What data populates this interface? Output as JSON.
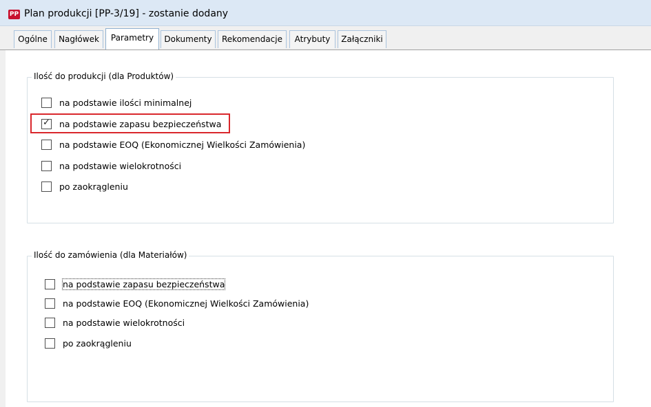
{
  "window": {
    "icon_text": "PP",
    "title": "Plan produkcji [PP-3/19] - zostanie dodany"
  },
  "tabs": [
    {
      "label": "Ogólne",
      "active": false
    },
    {
      "label": "Nagłówek",
      "active": false
    },
    {
      "label": "Parametry",
      "active": true
    },
    {
      "label": "Dokumenty",
      "active": false
    },
    {
      "label": "Rekomendacje",
      "active": false
    },
    {
      "label": "Atrybuty",
      "active": false
    },
    {
      "label": "Załączniki",
      "active": false
    }
  ],
  "group_products": {
    "legend": "Ilość do produkcji (dla Produktów)",
    "options": [
      {
        "label": "na podstawie ilości minimalnej",
        "checked": false
      },
      {
        "label": "na podstawie zapasu bezpieczeństwa",
        "checked": true,
        "highlighted": true
      },
      {
        "label": "na podstawie EOQ (Ekonomicznej Wielkości Zamówienia)",
        "checked": false
      },
      {
        "label": "na podstawie wielokrotności",
        "checked": false
      },
      {
        "label": "po zaokrągleniu",
        "checked": false
      }
    ]
  },
  "group_materials": {
    "legend": "Ilość do zamówienia (dla Materiałów)",
    "options": [
      {
        "label": "na podstawie zapasu bezpieczeństwa",
        "checked": false,
        "focused": true
      },
      {
        "label": "na podstawie EOQ (Ekonomicznej Wielkości Zamówienia)",
        "checked": false
      },
      {
        "label": "na podstawie wielokrotności",
        "checked": false
      },
      {
        "label": "po zaokrągleniu",
        "checked": false
      }
    ]
  },
  "colors": {
    "highlight": "#d9262b",
    "titlebar": "#dce8f5",
    "app_icon": "#c8102e"
  }
}
